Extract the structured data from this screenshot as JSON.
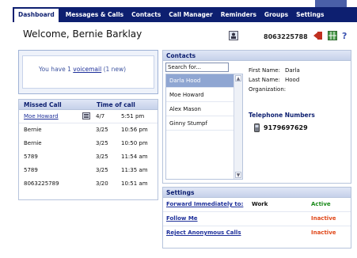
{
  "nav": {
    "tabs": [
      "Dashboard",
      "Messages & Calls",
      "Contacts",
      "Call Manager",
      "Reminders",
      "Groups",
      "Settings"
    ]
  },
  "header": {
    "welcome": "Welcome, Bernie Barklay",
    "phone": "8063225788",
    "icons": [
      "contact-card-icon",
      "logout-icon",
      "grid-icon",
      "help-icon"
    ]
  },
  "voicemail": {
    "prefix": "You have 1 ",
    "link": "voicemail",
    "suffix": " (1 new)"
  },
  "missed_calls": {
    "headers": [
      "Missed Call",
      "Time of call"
    ],
    "rows": [
      {
        "caller": "Moe Howard",
        "date": "4/7",
        "time": "5:51 pm"
      },
      {
        "caller": "Bernie",
        "date": "3/25",
        "time": "10:56 pm"
      },
      {
        "caller": "Bernie",
        "date": "3/25",
        "time": "10:50 pm"
      },
      {
        "caller": "5789",
        "date": "3/25",
        "time": "11:54 am"
      },
      {
        "caller": "5789",
        "date": "3/25",
        "time": "11:35 am"
      },
      {
        "caller": "8063225789",
        "date": "3/20",
        "time": "10:51 am"
      }
    ]
  },
  "contacts": {
    "title": "Contacts",
    "search_value": "Search for...",
    "list": [
      "Darla Hood",
      "Moe Howard",
      "Alex Mason",
      "Ginny Stumpf"
    ],
    "first_name_label": "First Name:",
    "first_name": "Darla",
    "last_name_label": "Last Name:",
    "last_name": "Hood",
    "organization_label": "Organization:",
    "organization": "",
    "telephone_title": "Telephone Numbers",
    "telephone": "9179697629"
  },
  "settings": {
    "title": "Settings",
    "rows": [
      {
        "label": "Forward Immediately to:",
        "value": "Work",
        "status": "Active",
        "status_color": "#1a8a1a"
      },
      {
        "label": "Follow Me",
        "value": "",
        "status": "Inactive",
        "status_color": "#e0481a"
      },
      {
        "label": "Reject Anonymous Calls",
        "value": "",
        "status": "Inactive",
        "status_color": "#e0481a"
      }
    ]
  },
  "colors": {
    "nav_bg": "#0d1f70",
    "link": "#1d2f9a",
    "active": "#1a8a1a",
    "inactive": "#e0481a"
  }
}
